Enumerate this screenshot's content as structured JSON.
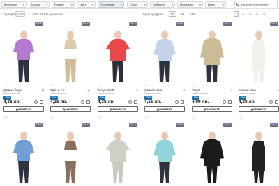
{
  "filters": [
    {
      "label": "Категории",
      "active": false
    },
    {
      "label": "Марки",
      "active": false
    },
    {
      "label": "Размер",
      "active": false
    },
    {
      "label": "Цвят",
      "active": false
    },
    {
      "label": "Състояние",
      "active": true
    },
    {
      "label": "Сезон",
      "active": false
    },
    {
      "label": "Добавено",
      "active": false
    },
    {
      "label": "Промоция",
      "active": false
    },
    {
      "label": "Цена",
      "active": false
    }
  ],
  "search": {
    "value": "Изчистете филтрите"
  },
  "toolbar": {
    "sort_label": "Сортиране по",
    "sort_value": "",
    "results": "1 - 30 от 11 611 резултата",
    "per_page_label": "Брой продукти:",
    "per_page_options": [
      "30",
      "60",
      "120"
    ],
    "pages": [
      "1",
      "2",
      "3",
      "4",
      "5"
    ]
  },
  "products": [
    {
      "brand": "Дамска блуза",
      "size": "M",
      "old_label": "начална цена",
      "old_price": "",
      "discount": "-75%",
      "price": "4,38 лв.",
      "badge": "SALE",
      "add_label": "ДОБАВЕТЕ",
      "colors": {
        "top": "#b57ad0",
        "bottom": "#2d3440"
      }
    },
    {
      "brand": "Style & Co",
      "size": "XL",
      "old_label": "начална цена",
      "old_price": "",
      "discount": "-75%",
      "price": "4,38 лв.",
      "badge": "SALE",
      "add_label": "ДОБАВЕТЕ",
      "colors": {
        "top": "#dccbab",
        "bottom": "#d2bd98"
      }
    },
    {
      "brand": "Jaclyn Smith",
      "size": "S",
      "old_label": "начална цена",
      "old_price": "",
      "discount": "-75%",
      "price": "4,38 лв.",
      "badge": "SALE",
      "add_label": "ДОБАВЕТЕ",
      "colors": {
        "top": "#e84848",
        "bottom": "#2b2f38"
      }
    },
    {
      "brand": "Дамска риза",
      "size": "M",
      "old_label": "начална цена",
      "old_price": "",
      "discount": "-75%",
      "price": "4,51 лв.",
      "badge": "SALE",
      "add_label": "ДОБАВЕТЕ",
      "colors": {
        "top": "#c5d3e8",
        "bottom": "#2d3440"
      }
    },
    {
      "brand": "Target",
      "size": "L",
      "old_label": "начална цена",
      "old_price": "",
      "discount": "-75%",
      "price": "4,99 лв.",
      "badge": "SALE",
      "add_label": "ДОБАВЕТЕ",
      "colors": {
        "top": "#cbbb96",
        "bottom": "#2d3440"
      }
    },
    {
      "brand": "Forever New",
      "size": "S",
      "old_label": "начална цена",
      "old_price": "",
      "discount": "-75%",
      "price": "4,38 лв.",
      "badge": "SALE",
      "add_label": "ДОБАВЕТЕ",
      "colors": {
        "top": "#f2f0ea",
        "bottom": "#f2f0ea"
      }
    },
    {
      "brand": "",
      "size": "",
      "old_label": "",
      "old_price": "",
      "discount": "",
      "price": "",
      "badge": "SALE",
      "add_label": "",
      "colors": {
        "top": "#6f9fd4",
        "bottom": "#2d3440"
      }
    },
    {
      "brand": "",
      "size": "",
      "old_label": "",
      "old_price": "",
      "discount": "",
      "price": "",
      "badge": "SALE",
      "add_label": "",
      "colors": {
        "top": "#8b6f5c",
        "bottom": "#8b6f5c"
      }
    },
    {
      "brand": "",
      "size": "",
      "old_label": "",
      "old_price": "",
      "discount": "",
      "price": "",
      "badge": "SALE",
      "add_label": "",
      "colors": {
        "top": "#cfcfc7",
        "bottom": "#c9c8bd"
      }
    },
    {
      "brand": "",
      "size": "",
      "old_label": "",
      "old_price": "",
      "discount": "",
      "price": "",
      "badge": "SALE",
      "add_label": "",
      "colors": {
        "top": "#8fd4d8",
        "bottom": "#2d3440"
      }
    },
    {
      "brand": "",
      "size": "",
      "old_label": "",
      "old_price": "",
      "discount": "",
      "price": "",
      "badge": "SALE",
      "add_label": "",
      "colors": {
        "top": "#1a1a1a",
        "bottom": "#1a1a1a"
      }
    },
    {
      "brand": "",
      "size": "",
      "old_label": "",
      "old_price": "",
      "discount": "",
      "price": "",
      "badge": "SALE",
      "add_label": "",
      "colors": {
        "top": "#222222",
        "bottom": "#222222"
      }
    }
  ],
  "icons": {
    "favorite": "heart-icon",
    "search": "search-icon",
    "bag": "bag-icon",
    "preview": "eye-icon",
    "dropdown": "chevron-down-icon"
  }
}
